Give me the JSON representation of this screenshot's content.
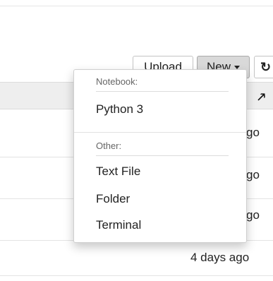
{
  "toolbar": {
    "upload_label": "Upload",
    "new_label": "New",
    "refresh_icon": "refresh-icon"
  },
  "list": {
    "sort_icon": "sort-arrow-up-icon"
  },
  "rows": [
    {
      "modified": "go"
    },
    {
      "modified": "go"
    },
    {
      "modified": "go"
    },
    {
      "modified": "4 days ago"
    }
  ],
  "menu": {
    "notebook_header": "Notebook:",
    "notebook_items": [
      "Python 3"
    ],
    "other_header": "Other:",
    "other_items": [
      "Text File",
      "Folder",
      "Terminal"
    ]
  },
  "colors": {
    "new_button_bg": "#d9d9d9",
    "list_header_bg": "#eeeeee"
  }
}
